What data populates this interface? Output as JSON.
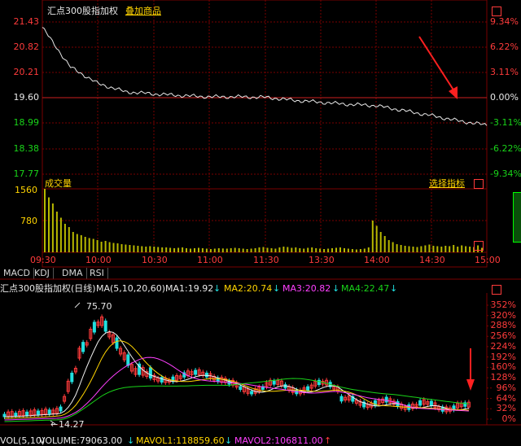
{
  "intraday": {
    "title": "汇点300股指加权",
    "overlay_link": "叠加商品",
    "price_labels": [
      "21.43",
      "20.82",
      "20.21",
      "19.60",
      "18.99",
      "18.38",
      "17.77"
    ],
    "pct_labels": [
      "9.34%",
      "6.22%",
      "3.11%",
      "0.00%",
      "-3.11%",
      "-6.22%",
      "-9.34%"
    ],
    "volume_title": "成交量",
    "volume_labels": [
      "1560",
      "780"
    ],
    "indicator_link": "选择指标",
    "time_labels": [
      "09:30",
      "10:00",
      "10:30",
      "11:00",
      "11:30",
      "13:30",
      "14:00",
      "14:30",
      "15:00"
    ]
  },
  "tabs": [
    "MACD",
    "KDJ",
    "DMA",
    "RSI"
  ],
  "daily": {
    "header_title": "汇点300股指加权(日线)",
    "ma_label": "MA(5,10,20,60)",
    "ma1": "MA1:19.92",
    "ma2": "MA2:20.74",
    "ma3": "MA3:20.82",
    "ma4": "MA4:22.47",
    "high_marker": "75.70",
    "low_marker": "14.27",
    "pct_scale": [
      "352%",
      "320%",
      "288%",
      "256%",
      "224%",
      "192%",
      "160%",
      "128%",
      "96%",
      "64%",
      "32%",
      "0%"
    ]
  },
  "volume_footer": {
    "vol": "VOL(5,10)",
    "volume": "VOLUME:79063.00",
    "mavol1": "MAVOL1:118859.60",
    "mavol2": "MAVOL2:106811.00"
  },
  "chart_data": {
    "type": "line",
    "x": [
      "09:30",
      "09:45",
      "10:00",
      "10:15",
      "10:30",
      "10:45",
      "11:00",
      "11:15",
      "11:30",
      "13:15",
      "13:30",
      "13:45",
      "14:00",
      "14:15",
      "14:30",
      "14:45",
      "15:00"
    ],
    "series": [
      {
        "values": [
          21.3,
          20.35,
          19.95,
          19.75,
          19.7,
          19.66,
          19.63,
          19.63,
          19.62,
          19.55,
          19.5,
          19.45,
          19.42,
          19.3,
          19.18,
          19.05,
          18.95
        ]
      }
    ],
    "ylim": [
      17.77,
      21.43
    ],
    "volume": [
      1560,
      1350,
      1200,
      1000,
      850,
      700,
      620,
      500,
      450,
      420,
      380,
      350,
      330,
      300,
      260,
      280,
      250,
      230,
      220,
      200,
      190,
      180,
      170,
      160,
      150,
      140,
      150,
      140,
      130,
      120,
      120,
      110,
      100,
      110,
      120,
      100,
      90,
      100,
      110,
      100,
      90,
      80,
      90,
      100,
      95,
      90,
      100,
      110,
      100,
      90,
      80,
      90,
      100,
      120,
      130,
      110,
      100,
      90,
      120,
      140,
      130,
      110,
      120,
      100,
      90,
      110,
      120,
      100,
      90,
      80,
      90,
      100,
      110,
      120,
      100,
      90,
      80,
      70,
      80,
      90,
      120,
      780,
      650,
      500,
      400,
      300,
      250,
      200,
      180,
      160,
      150,
      140,
      130,
      150,
      170,
      190,
      160,
      150,
      140,
      160,
      150,
      180,
      140,
      170,
      150,
      140,
      130,
      170,
      110
    ]
  },
  "colors": {
    "up": "#ff3b3b",
    "down": "#19d419",
    "price_line": "#e8e8e8",
    "volume": "#b8b800",
    "grid": "#7a0000"
  }
}
